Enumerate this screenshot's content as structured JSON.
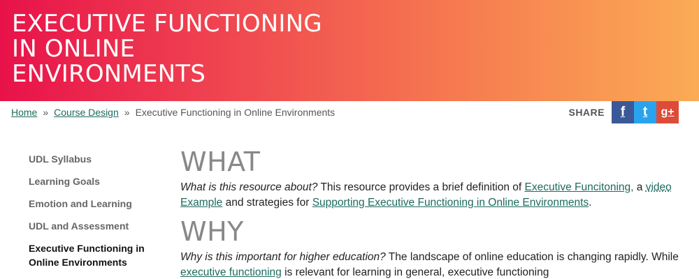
{
  "hero": {
    "title_lines": [
      "EXECUTIVE FUNCTIONING",
      "IN ONLINE",
      "ENVIRONMENTS"
    ],
    "gradient_colors": [
      "#e8124a",
      "#fbab55"
    ]
  },
  "breadcrumb": {
    "home": "Home",
    "sep": "»",
    "course_design": "Course Design",
    "current": "Executive Functioning in Online Environments"
  },
  "share": {
    "label": "SHARE",
    "facebook_glyph": "f",
    "twitter_glyph": "t",
    "googleplus_glyph": "g+",
    "icons": [
      "facebook-icon",
      "twitter-icon",
      "google-plus-icon"
    ]
  },
  "sidebar": {
    "items": [
      {
        "label": "UDL Syllabus"
      },
      {
        "label": "Learning Goals"
      },
      {
        "label": "Emotion and Learning"
      },
      {
        "label": "UDL and Assessment"
      },
      {
        "label": "Executive Functioning in Online Environments",
        "active": true
      }
    ]
  },
  "what": {
    "heading": "WHAT",
    "question": "What is this resource about?",
    "text1": " This resource provides a brief definition of ",
    "link1": "Executive Funcitoning,",
    "text2": " a ",
    "link2": "video",
    "text3": " ",
    "link3": "Example",
    "text4": " and strategies for ",
    "link4": "Supporting Executive Functioning in Online Environments",
    "text5": "."
  },
  "why": {
    "heading": "WHY",
    "question": "Why is this important for higher education?",
    "text1": " The landscape of online education is changing rapidly. While ",
    "link1": "executive functioning",
    "text2": " is relevant for learning in general, executive functioning"
  },
  "colors": {
    "link": "#1d6a5e",
    "heading": "#888888",
    "facebook": "#3b5998",
    "twitter": "#2aa3ef",
    "googleplus": "#dd4b39"
  }
}
